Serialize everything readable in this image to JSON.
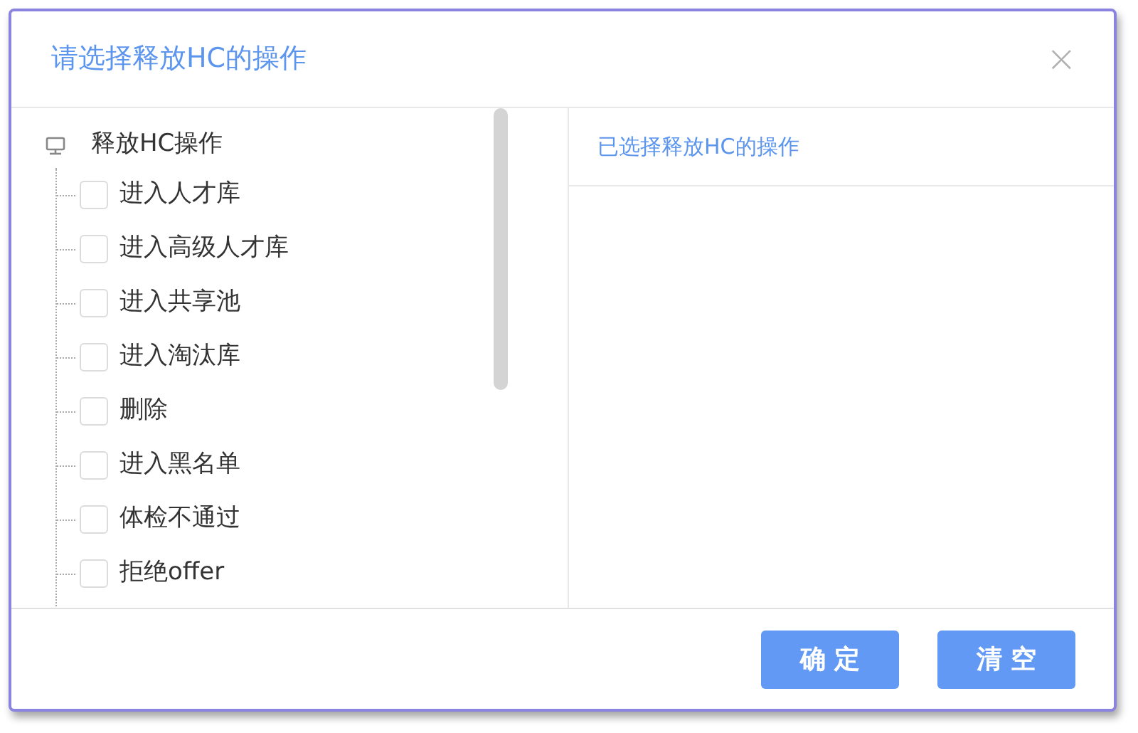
{
  "dialog": {
    "title": "请选择释放HC的操作",
    "close": "×"
  },
  "tree": {
    "label": "释放HC操作",
    "children": [
      {
        "label": "进入人才库",
        "checked": false
      },
      {
        "label": "进入高级人才库",
        "checked": false
      },
      {
        "label": "进入共享池",
        "checked": false
      },
      {
        "label": "进入淘汰库",
        "checked": false
      },
      {
        "label": "删除",
        "checked": false
      },
      {
        "label": "进入黑名单",
        "checked": false
      },
      {
        "label": "体检不通过",
        "checked": false
      },
      {
        "label": "拒绝offer",
        "checked": false
      }
    ]
  },
  "selected_panel": {
    "title": "已选择释放HC的操作"
  },
  "buttons": [
    "确 定",
    "清 空"
  ]
}
